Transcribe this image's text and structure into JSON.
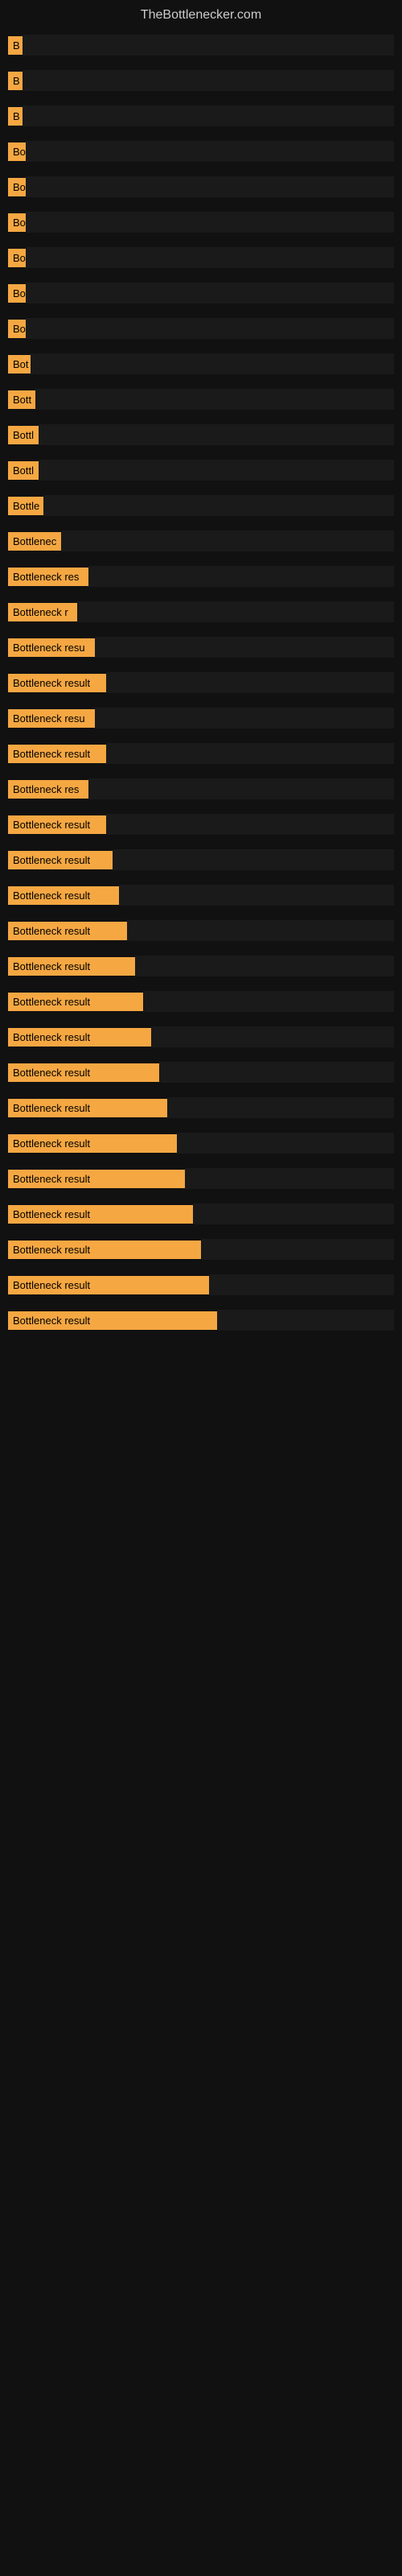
{
  "site": {
    "title": "TheBottlenecker.com"
  },
  "rows": [
    {
      "label": "B",
      "labelWidth": 18,
      "truncated": true
    },
    {
      "label": "B",
      "labelWidth": 18,
      "truncated": true
    },
    {
      "label": "B",
      "labelWidth": 18,
      "truncated": true
    },
    {
      "label": "Bo",
      "labelWidth": 22,
      "truncated": true
    },
    {
      "label": "Bo",
      "labelWidth": 22,
      "truncated": true
    },
    {
      "label": "Bo",
      "labelWidth": 22,
      "truncated": true
    },
    {
      "label": "Bo",
      "labelWidth": 22,
      "truncated": true
    },
    {
      "label": "Bo",
      "labelWidth": 22,
      "truncated": true
    },
    {
      "label": "Bo",
      "labelWidth": 22,
      "truncated": true
    },
    {
      "label": "Bot",
      "labelWidth": 28,
      "truncated": true
    },
    {
      "label": "Bott",
      "labelWidth": 34,
      "truncated": true
    },
    {
      "label": "Bottl",
      "labelWidth": 38,
      "truncated": true
    },
    {
      "label": "Bottl",
      "labelWidth": 38,
      "truncated": true
    },
    {
      "label": "Bottle",
      "labelWidth": 44,
      "truncated": true
    },
    {
      "label": "Bottlenec",
      "labelWidth": 66,
      "truncated": true
    },
    {
      "label": "Bottleneck res",
      "labelWidth": 100,
      "truncated": true
    },
    {
      "label": "Bottleneck r",
      "labelWidth": 86,
      "truncated": true
    },
    {
      "label": "Bottleneck resu",
      "labelWidth": 108,
      "truncated": true
    },
    {
      "label": "Bottleneck result",
      "labelWidth": 122,
      "truncated": false
    },
    {
      "label": "Bottleneck resu",
      "labelWidth": 108,
      "truncated": true
    },
    {
      "label": "Bottleneck result",
      "labelWidth": 122,
      "truncated": false
    },
    {
      "label": "Bottleneck res",
      "labelWidth": 100,
      "truncated": true
    },
    {
      "label": "Bottleneck result",
      "labelWidth": 122,
      "truncated": false
    },
    {
      "label": "Bottleneck result",
      "labelWidth": 130,
      "truncated": false
    },
    {
      "label": "Bottleneck result",
      "labelWidth": 138,
      "truncated": false
    },
    {
      "label": "Bottleneck result",
      "labelWidth": 148,
      "truncated": false
    },
    {
      "label": "Bottleneck result",
      "labelWidth": 158,
      "truncated": false
    },
    {
      "label": "Bottleneck result",
      "labelWidth": 168,
      "truncated": false
    },
    {
      "label": "Bottleneck result",
      "labelWidth": 178,
      "truncated": false
    },
    {
      "label": "Bottleneck result",
      "labelWidth": 188,
      "truncated": false
    },
    {
      "label": "Bottleneck result",
      "labelWidth": 198,
      "truncated": false
    },
    {
      "label": "Bottleneck result",
      "labelWidth": 210,
      "truncated": false
    },
    {
      "label": "Bottleneck result",
      "labelWidth": 220,
      "truncated": false
    },
    {
      "label": "Bottleneck result",
      "labelWidth": 230,
      "truncated": false
    },
    {
      "label": "Bottleneck result",
      "labelWidth": 240,
      "truncated": false
    },
    {
      "label": "Bottleneck result",
      "labelWidth": 250,
      "truncated": false
    },
    {
      "label": "Bottleneck result",
      "labelWidth": 260,
      "truncated": false
    }
  ]
}
